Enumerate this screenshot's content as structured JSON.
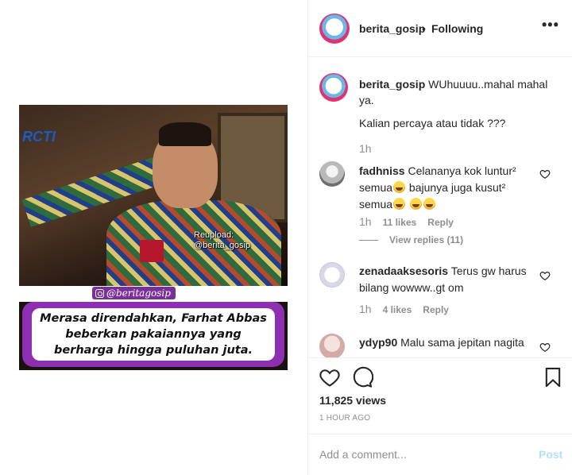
{
  "media": {
    "tv_logo": "RCTI",
    "reupload_line1": "Reupload:",
    "reupload_line2": "@berita_gosip",
    "handle_tag": "@beritagosip",
    "caption": "Merasa direndahkan, Farhat Abbas beberkan pakaiannya yang berharga hingga puluhan juta."
  },
  "header": {
    "username": "berita_gosip",
    "dot": "•",
    "follow_status": "Following",
    "more_icon": "more-horizontal-icon",
    "more_label": "•••"
  },
  "owner_caption": {
    "username": "berita_gosip",
    "text": "WUhuuuu..mahal mahal ya.",
    "line2": "Kalian percaya atau tidak ???",
    "time": "1h"
  },
  "comments": [
    {
      "username": "fadhniss",
      "text_part1": "Celananya kok luntur² semua",
      "text_part2": " bajunya juga kusut² semua",
      "time": "1h",
      "likes": "11 likes",
      "reply": "Reply",
      "view_replies": "View replies (11)"
    },
    {
      "username": "zenadaaksesoris",
      "text": "Terus gw harus bilang wowww..gt om",
      "time": "1h",
      "likes": "4 likes",
      "reply": "Reply"
    },
    {
      "username": "ydyp90",
      "text": "Malu sama jepitan nagita"
    }
  ],
  "actions": {
    "like_icon": "heart-icon",
    "comment_icon": "comment-icon",
    "save_icon": "bookmark-icon",
    "views": "11,825 views",
    "time_ago": "1 HOUR AGO"
  },
  "composer": {
    "placeholder": "Add a comment...",
    "post_label": "Post"
  },
  "colors": {
    "text": "#262626",
    "muted": "#8e8e8e",
    "post_disabled": "#b2dffc",
    "caption_frame": "#8d2fb0"
  }
}
